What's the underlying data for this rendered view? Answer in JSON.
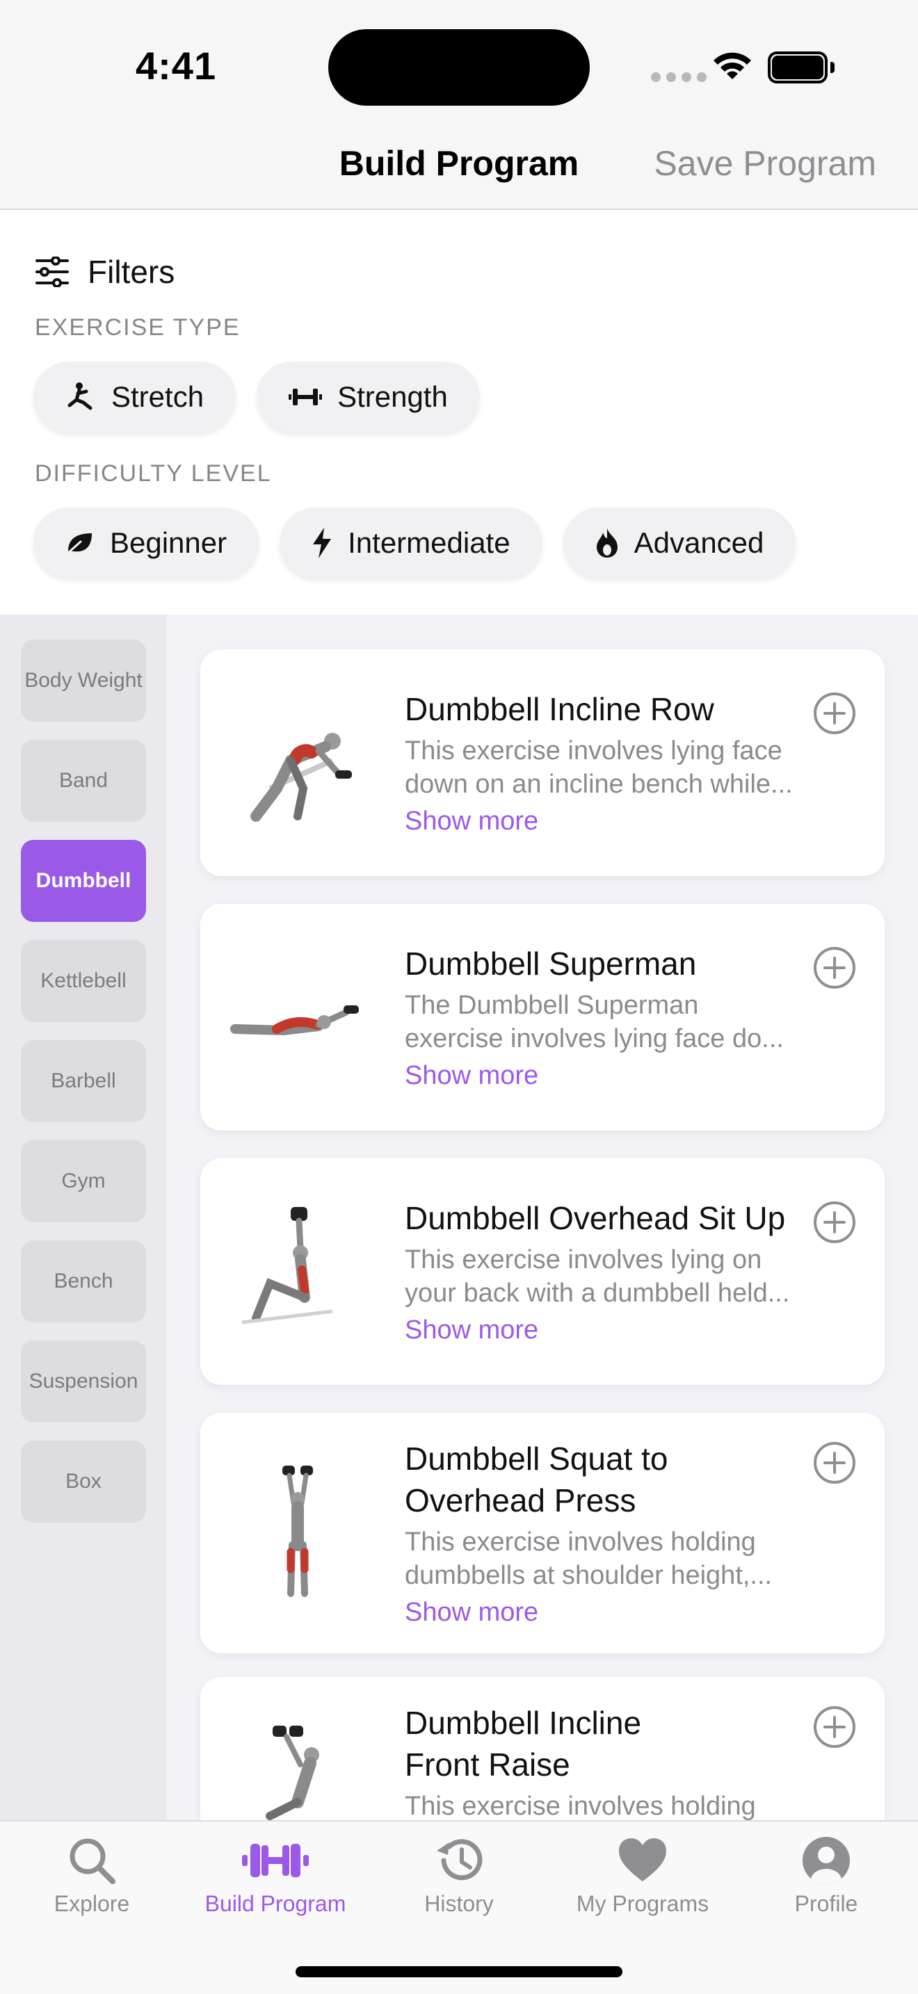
{
  "status_bar": {
    "time": "4:41"
  },
  "nav": {
    "title": "Build Program",
    "action": "Save Program"
  },
  "filters": {
    "title": "Filters",
    "exercise_type_label": "EXERCISE TYPE",
    "exercise_types": [
      "Stretch",
      "Strength"
    ],
    "difficulty_label": "DIFFICULTY LEVEL",
    "difficulties": [
      "Beginner",
      "Intermediate",
      "Advanced"
    ]
  },
  "equipment": {
    "items": [
      "Body Weight",
      "Band",
      "Dumbbell",
      "Kettlebell",
      "Barbell",
      "Gym",
      "Bench",
      "Suspension",
      "Box"
    ],
    "selected": "Dumbbell"
  },
  "exercises": [
    {
      "title": "Dumbbell Incline Row",
      "desc_line1": "This exercise involves lying face",
      "desc_line2": "down on an incline bench while...",
      "more": "Show more"
    },
    {
      "title": "Dumbbell Superman",
      "desc_line1": "The Dumbbell Superman",
      "desc_line2": "exercise involves lying face do...",
      "more": "Show more"
    },
    {
      "title": "Dumbbell Overhead Sit Up",
      "desc_line1": "This exercise involves lying on",
      "desc_line2": "your back with a dumbbell held...",
      "more": "Show more"
    },
    {
      "title_line1": "Dumbbell Squat to",
      "title_line2": "Overhead Press",
      "desc_line1": "This exercise involves holding",
      "desc_line2": "dumbbells at shoulder height,...",
      "more": "Show more"
    },
    {
      "title_line1": "Dumbbell Incline",
      "title_line2": "Front Raise",
      "desc_line1": "This exercise involves holding"
    }
  ],
  "tabs": [
    {
      "label": "Explore",
      "icon": "search-icon"
    },
    {
      "label": "Build Program",
      "icon": "dumbbell-icon"
    },
    {
      "label": "History",
      "icon": "history-icon"
    },
    {
      "label": "My Programs",
      "icon": "heart-icon"
    },
    {
      "label": "Profile",
      "icon": "profile-icon"
    }
  ],
  "colors": {
    "accent": "#9b59e8",
    "muted": "#8e8e93",
    "chip": "#f1f1f4"
  }
}
